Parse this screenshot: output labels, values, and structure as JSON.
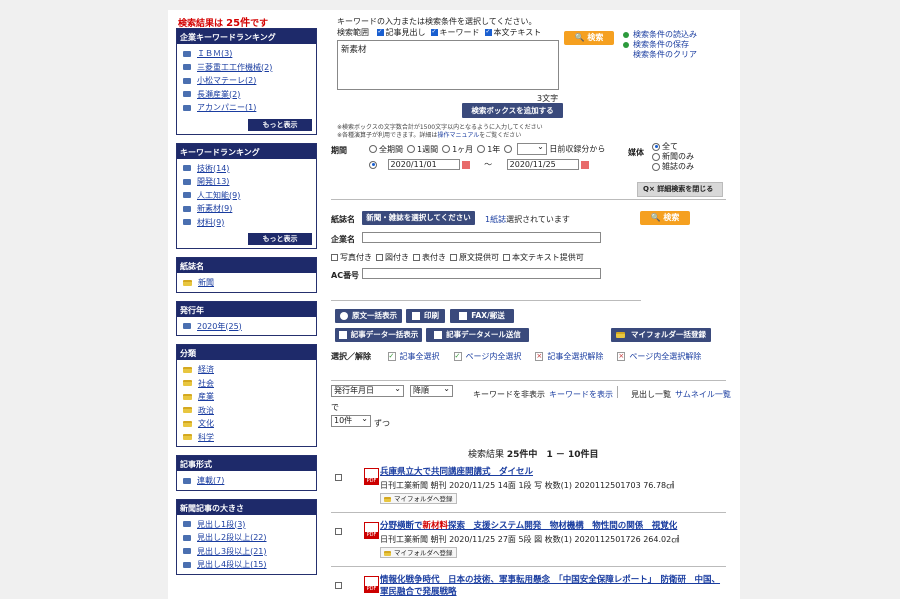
{
  "sidebar": {
    "result_prefix": "検索結果は",
    "result_count": "25件",
    "result_suffix": "です",
    "more_label": "もっと表示",
    "boxes": [
      {
        "title": "企業キーワードランキング",
        "icon": "doc-icon",
        "more": true,
        "items": [
          "ＩＢＭ(3)",
          "三菱重工工作機械(2)",
          "小松マテーレ(2)",
          "長瀬産業(2)",
          "アカンパニー(1)"
        ]
      },
      {
        "title": "キーワードランキング",
        "icon": "doc-icon",
        "more": true,
        "items": [
          "技術(14)",
          "開発(13)",
          "人工知能(9)",
          "新素材(9)",
          "材料(9)"
        ]
      },
      {
        "title": "紙誌名",
        "icon": "folder-icon",
        "more": false,
        "items": [
          "新聞"
        ]
      },
      {
        "title": "発行年",
        "icon": "doc-icon",
        "more": false,
        "items": [
          "2020年(25)"
        ]
      },
      {
        "title": "分類",
        "icon": "folder-icon",
        "more": false,
        "items": [
          "経済",
          "社会",
          "産業",
          "政治",
          "文化",
          "科学"
        ]
      },
      {
        "title": "記事形式",
        "icon": "doc-icon",
        "more": false,
        "items": [
          "連載(7)"
        ]
      },
      {
        "title": "新聞記事の大きさ",
        "icon": "doc-icon",
        "more": false,
        "items": [
          "見出し1段(3)",
          "見出し2段以上(22)",
          "見出し3段以上(21)",
          "見出し4段以上(15)"
        ]
      }
    ]
  },
  "search": {
    "instruction": "キーワードの入力または検索条件を選択してください。",
    "scope_label": "検索範囲",
    "scope_options": [
      {
        "label": "記事見出し",
        "checked": true
      },
      {
        "label": "キーワード",
        "checked": true
      },
      {
        "label": "本文テキスト",
        "checked": true
      }
    ],
    "search_button": "検索",
    "side_links": [
      "検索条件の読込み",
      "検索条件の保存",
      "検索条件のクリア"
    ],
    "keyword_value": "新素材",
    "char_count": "3文字",
    "add_box_button": "検索ボックスを追加する",
    "note1": "※検索ボックスの文字数合計が1500文字以内となるように入力してください",
    "note2_prefix": "※各種演算子が利用できます。詳細は",
    "note2_link": "操作マニュアル",
    "note2_suffix": "をご覧ください",
    "period_label": "期間",
    "period_options": [
      "全期間",
      "1週間",
      "1ヶ月",
      "1年"
    ],
    "period_suffix": "日前収録分から",
    "date_from": "2020/11/01",
    "date_sep": "～",
    "date_to": "2020/11/25",
    "media_label": "媒体",
    "media_options": [
      {
        "label": "全て",
        "selected": true
      },
      {
        "label": "新聞のみ",
        "selected": false
      },
      {
        "label": "雑誌のみ",
        "selected": false
      }
    ],
    "close_detail_button": "詳細検索を閉じる",
    "magazine_label": "紙誌名",
    "magazine_select_button": "新聞・雑誌を選択してください",
    "magazine_count_link": "1紙誌",
    "magazine_count_suffix": "選択されています",
    "search_button2": "検索",
    "company_label": "企業名",
    "company_value": "",
    "filters": [
      "写真付き",
      "図付き",
      "表付き",
      "原文提供可",
      "本文テキスト提供可"
    ],
    "ac_label": "AC番号",
    "ac_value": ""
  },
  "actions": {
    "row1": [
      "原文一括表示",
      "印刷",
      "FAX/郵送"
    ],
    "row2": [
      "記事データ一括表示",
      "記事データメール送信"
    ],
    "folder_bulk": "マイフォルダ一括登録",
    "select_label": "選択／解除",
    "select_links": [
      "記事全選択",
      "ページ内全選択",
      "記事全選択解除",
      "ページ内全選択解除"
    ]
  },
  "sort": {
    "sort_by": "発行年月日",
    "order": "降順",
    "hide_keyword": "キーワードを非表示",
    "show_keyword": "キーワードを表示",
    "view_list": "見出し一覧",
    "view_thumb": "サムネイル一覧",
    "de": "で",
    "per_page": "10件",
    "zutsu": "ずつ"
  },
  "results": {
    "summary_prefix": "検索結果",
    "total": "25件中",
    "range": "1 － 10件目",
    "folder_button": "マイフォルダへ登録",
    "items": [
      {
        "title_a": "兵庫県立大で共同講座開講式　ダイセル",
        "title_hl": "",
        "title_b": "",
        "meta": "日刊工業新聞 朝刊 2020/11/25 14面 1段 写 枚数(1) 2020112501703 76.78㎠"
      },
      {
        "title_a": "分野横断で",
        "title_hl": "新材料",
        "title_b": "探索　支援システム開発　物材機構　物性間の関係　視覚化",
        "meta": "日刊工業新聞 朝刊 2020/11/25 27面 5段 図 枚数(1) 2020112501726 264.02㎠"
      },
      {
        "title_a": "情報化戦争時代　日本の技術、軍事転用懸念　「中国安全保障レポート」　防衛研　中国、軍民融合で発展戦略",
        "title_hl": "",
        "title_b": "",
        "meta": ""
      }
    ]
  }
}
